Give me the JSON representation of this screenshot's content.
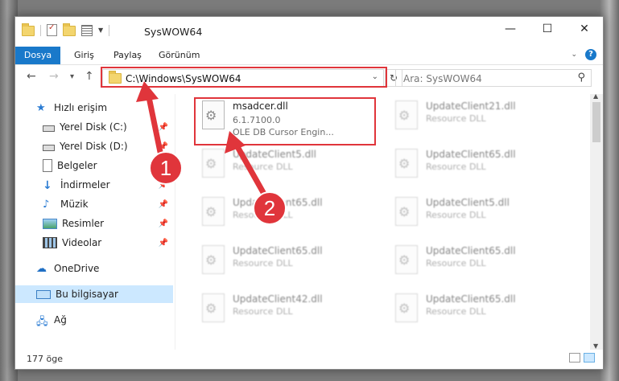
{
  "window": {
    "title": "SysWOW64",
    "controls": {
      "minimize": "—",
      "maximize": "☐",
      "close": "✕"
    }
  },
  "ribbon": {
    "tabs": [
      "Dosya",
      "Giriş",
      "Paylaş",
      "Görünüm"
    ],
    "help": "?"
  },
  "navigation": {
    "back": "←",
    "forward": "→",
    "recent": "▾",
    "up": "↑",
    "address": "C:\\Windows\\SysWOW64",
    "refresh": "↻",
    "search_placeholder": "Ara: SysWOW64"
  },
  "sidebar": {
    "items": [
      {
        "label": "Hızlı erişim",
        "icon": "star-icon"
      },
      {
        "label": "Yerel Disk (C:)",
        "icon": "drive-icon",
        "pinned": true
      },
      {
        "label": "Yerel Disk (D:)",
        "icon": "drive-icon",
        "pinned": true
      },
      {
        "label": "Belgeler",
        "icon": "documents-icon",
        "pinned": true
      },
      {
        "label": "İndirmeler",
        "icon": "download-icon",
        "pinned": true
      },
      {
        "label": "Müzik",
        "icon": "music-icon",
        "pinned": true
      },
      {
        "label": "Resimler",
        "icon": "pictures-icon",
        "pinned": true
      },
      {
        "label": "Videolar",
        "icon": "video-icon",
        "pinned": true
      },
      {
        "label": "OneDrive",
        "icon": "cloud-icon"
      },
      {
        "label": "Bu bilgisayar",
        "icon": "computer-icon",
        "selected": true
      },
      {
        "label": "Ağ",
        "icon": "network-icon"
      }
    ]
  },
  "files": {
    "highlighted": {
      "name": "msadcer.dll",
      "version": "6.1.7100.0",
      "description": "OLE DB Cursor Engin..."
    },
    "col1": [
      {
        "name": "UpdateClient5.dll",
        "sub": "Resource DLL"
      },
      {
        "name": "UpdateClient65.dll",
        "sub": "Resource DLL"
      },
      {
        "name": "UpdateClient65.dll",
        "sub": "Resource DLL"
      },
      {
        "name": "UpdateClient42.dll",
        "sub": "Resource DLL"
      }
    ],
    "col2": [
      {
        "name": "UpdateClient21.dll",
        "sub": "Resource DLL"
      },
      {
        "name": "UpdateClient65.dll",
        "sub": "Resource DLL"
      },
      {
        "name": "UpdateClient5.dll",
        "sub": "Resource DLL"
      },
      {
        "name": "UpdateClient65.dll",
        "sub": "Resource DLL"
      },
      {
        "name": "UpdateClient65.dll",
        "sub": "Resource DLL"
      }
    ]
  },
  "status": {
    "count": "177 öge"
  },
  "annotations": {
    "callout1": "1",
    "callout2": "2",
    "accent_color": "#e0353b"
  }
}
